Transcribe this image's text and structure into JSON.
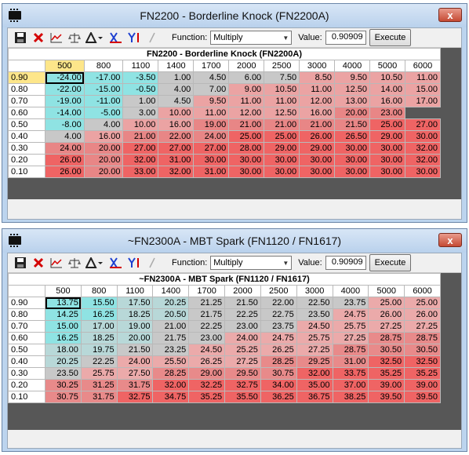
{
  "windows": [
    {
      "title": "FN2200 - Borderline Knock (FN2200A)",
      "close": "x",
      "toolbar": {
        "function_label": "Function:",
        "function_value": "Multiply",
        "value_label": "Value:",
        "value": "0.90909",
        "execute_label": "Execute"
      },
      "table_caption": "FN2200 - Borderline Knock (FN2200A)",
      "columns": [
        "500",
        "800",
        "1100",
        "1400",
        "1700",
        "2000",
        "2500",
        "3000",
        "4000",
        "5000",
        "6000"
      ],
      "rows": [
        {
          "label": "0.90",
          "values": [
            "-24.00",
            "-17.00",
            "-3.50",
            "1.00",
            "4.50",
            "6.00",
            "7.50",
            "8.50",
            "9.50",
            "10.50",
            "11.00"
          ]
        },
        {
          "label": "0.80",
          "values": [
            "-22.00",
            "-15.00",
            "-0.50",
            "4.00",
            "7.00",
            "9.00",
            "10.50",
            "11.00",
            "12.50",
            "14.00",
            "15.00"
          ]
        },
        {
          "label": "0.70",
          "values": [
            "-19.00",
            "-11.00",
            "1.00",
            "4.50",
            "9.50",
            "11.00",
            "11.00",
            "12.00",
            "13.00",
            "16.00",
            "17.00"
          ]
        },
        {
          "label": "0.60",
          "values": [
            "-14.00",
            "-5.00",
            "3.00",
            "10.00",
            "11.00",
            "12.00",
            "12.50",
            "16.00",
            "20.00",
            "23.00"
          ]
        },
        {
          "label": "0.50",
          "values": [
            "-8.00",
            "4.00",
            "10.00",
            "16.00",
            "19.00",
            "21.00",
            "21.00",
            "21.00",
            "21.50",
            "25.00",
            "27.00"
          ]
        },
        {
          "label": "0.40",
          "values": [
            "4.00",
            "16.00",
            "21.00",
            "22.00",
            "24.00",
            "25.00",
            "25.00",
            "26.00",
            "26.50",
            "29.00",
            "30.00"
          ]
        },
        {
          "label": "0.30",
          "values": [
            "24.00",
            "20.00",
            "27.00",
            "27.00",
            "27.00",
            "28.00",
            "29.00",
            "29.00",
            "30.00",
            "30.00",
            "32.00"
          ]
        },
        {
          "label": "0.20",
          "values": [
            "26.00",
            "20.00",
            "32.00",
            "31.00",
            "30.00",
            "30.00",
            "30.00",
            "30.00",
            "30.00",
            "30.00",
            "32.00"
          ]
        },
        {
          "label": "0.10",
          "values": [
            "26.00",
            "20.00",
            "33.00",
            "32.00",
            "31.00",
            "30.00",
            "30.00",
            "30.00",
            "30.00",
            "30.00",
            "30.00"
          ]
        }
      ]
    },
    {
      "title": "~FN2300A - MBT Spark (FN1120 / FN1617)",
      "close": "x",
      "toolbar": {
        "function_label": "Function:",
        "function_value": "Multiply",
        "value_label": "Value:",
        "value": "0.90909",
        "execute_label": "Execute"
      },
      "table_caption": "~FN2300A - MBT Spark (FN1120 / FN1617)",
      "columns": [
        "500",
        "800",
        "1100",
        "1400",
        "1700",
        "2000",
        "2500",
        "3000",
        "4000",
        "5000",
        "6000"
      ],
      "rows": [
        {
          "label": "0.90",
          "values": [
            "13.75",
            "15.50",
            "17.50",
            "20.25",
            "21.25",
            "21.50",
            "22.00",
            "22.50",
            "23.75",
            "25.00",
            "25.00"
          ]
        },
        {
          "label": "0.80",
          "values": [
            "14.25",
            "16.25",
            "18.25",
            "20.50",
            "21.75",
            "22.25",
            "22.75",
            "23.50",
            "24.75",
            "26.00",
            "26.00"
          ]
        },
        {
          "label": "0.70",
          "values": [
            "15.00",
            "17.00",
            "19.00",
            "21.00",
            "22.25",
            "23.00",
            "23.75",
            "24.50",
            "25.75",
            "27.25",
            "27.25"
          ]
        },
        {
          "label": "0.60",
          "values": [
            "16.25",
            "18.25",
            "20.00",
            "21.75",
            "23.00",
            "24.00",
            "24.75",
            "25.75",
            "27.25",
            "28.75",
            "28.75"
          ]
        },
        {
          "label": "0.50",
          "values": [
            "18.00",
            "19.75",
            "21.50",
            "23.25",
            "24.50",
            "25.25",
            "26.25",
            "27.25",
            "28.75",
            "30.50",
            "30.50"
          ]
        },
        {
          "label": "0.40",
          "values": [
            "20.25",
            "22.25",
            "24.00",
            "25.50",
            "26.25",
            "27.25",
            "28.25",
            "29.25",
            "31.00",
            "32.50",
            "32.50"
          ]
        },
        {
          "label": "0.30",
          "values": [
            "23.50",
            "25.75",
            "27.50",
            "28.25",
            "29.00",
            "29.50",
            "30.75",
            "32.00",
            "33.75",
            "35.25",
            "35.25"
          ]
        },
        {
          "label": "0.20",
          "values": [
            "30.25",
            "31.25",
            "31.75",
            "32.00",
            "32.25",
            "32.75",
            "34.00",
            "35.00",
            "37.00",
            "39.00",
            "39.00"
          ]
        },
        {
          "label": "0.10",
          "values": [
            "30.75",
            "31.75",
            "32.75",
            "34.75",
            "35.25",
            "35.50",
            "36.25",
            "36.75",
            "38.25",
            "39.50",
            "39.50"
          ]
        }
      ]
    }
  ]
}
